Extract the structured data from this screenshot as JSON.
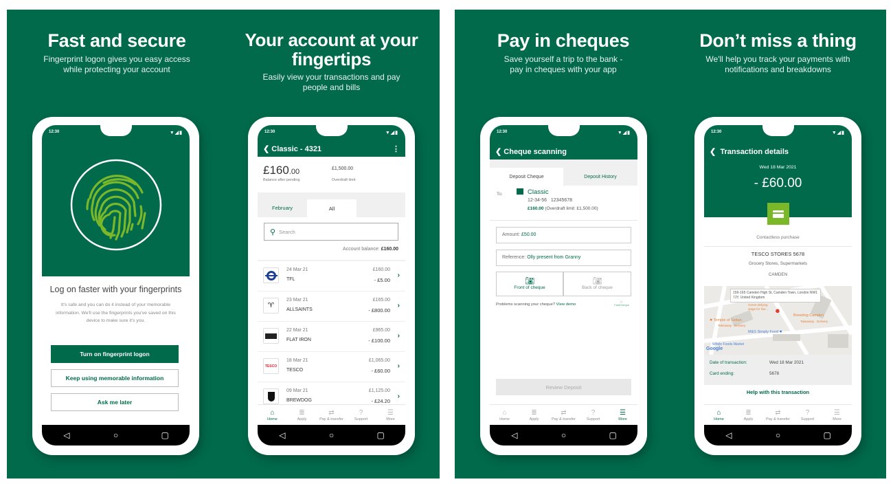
{
  "colors": {
    "brand_green": "#016a4b",
    "accent_lime": "#6ab023",
    "page_bg": "#ffffff"
  },
  "status_bar": {
    "time": "12:30",
    "icons": "▼◢▮"
  },
  "system_nav": {
    "back": "◁",
    "home": "○",
    "recents": "▢"
  },
  "tab_bar": [
    {
      "label": "Home",
      "icon": "home-icon",
      "glyph": "⌂"
    },
    {
      "label": "Apply",
      "icon": "apply-icon",
      "glyph": "≣"
    },
    {
      "label": "Pay & transfer",
      "icon": "pay-transfer-icon",
      "glyph": "⇄"
    },
    {
      "label": "Support",
      "icon": "support-icon",
      "glyph": "?"
    },
    {
      "label": "More",
      "icon": "menu-icon",
      "glyph": "☰"
    }
  ],
  "slides": [
    {
      "title": "Fast and secure",
      "subtitle": "Fingerprint logon gives you easy access while protecting your account"
    },
    {
      "title": "Your account at your fingertips",
      "subtitle": "Easily view your transactions and pay people and bills"
    },
    {
      "title": "Pay in cheques",
      "subtitle": "Save yourself a trip to the bank - pay in cheques with your app"
    },
    {
      "title": "Don’t miss a thing",
      "subtitle": "We'll help you track your payments with notifications and breakdowns"
    }
  ],
  "fingerprint": {
    "heading": "Log on faster with your fingerprints",
    "body": "It's safe and you can do it instead of your memorable information. We'll use the fingerprints you've saved on this device to make sure it's you.",
    "primary_button": "Turn on fingerprint logon",
    "secondary_button": "Keep using memorable information",
    "tertiary_button": "Ask me later"
  },
  "account": {
    "title": "Classic - 4321",
    "balance_main": "£160",
    "balance_pence": ".00",
    "balance_label": "Balance after pending",
    "overdraft": "£1,500.00",
    "overdraft_label": "Overdraft limit",
    "tabs": [
      "February",
      "All"
    ],
    "active_tab": "All",
    "search_placeholder": "Search",
    "account_balance_label": "Account balance:",
    "account_balance_value": "£160.00",
    "transactions": [
      {
        "date": "24 Mar 21",
        "name": "TFL",
        "balance": "£160.00",
        "amount": "- £5.00",
        "logo": "tfl-logo"
      },
      {
        "date": "23 Mar 21",
        "name": "ALLSAINTS",
        "balance": "£165.00",
        "amount": "- £800.00",
        "logo": "allsaints-logo"
      },
      {
        "date": "22 Mar 21",
        "name": "FLAT IRON",
        "balance": "£965.00",
        "amount": "- £100.00",
        "logo": "flat-iron-logo"
      },
      {
        "date": "18 Mar 21",
        "name": "TESCO",
        "balance": "£1,065.00",
        "amount": "- £60.00",
        "logo": "tesco-logo"
      },
      {
        "date": "09 Mar 21",
        "name": "BREWDOG",
        "balance": "£1,125.00",
        "amount": "- £24.20",
        "logo": "brewdog-logo"
      }
    ],
    "tesco_logo_text": "TESCO"
  },
  "cheque": {
    "title": "Cheque scanning",
    "tabs": [
      "Deposit Cheque",
      "Deposit History"
    ],
    "to_label": "To:",
    "account_name": "Classic",
    "sort_code": "12-34-56",
    "account_number": "12345678",
    "balance": "£160.00",
    "overdraft_note": "(Overdraft limit: £1,500.00)",
    "amount_label": "Amount:",
    "amount_value": "£50.00",
    "reference_label": "Reference:",
    "reference_value": "Olly present from Granny",
    "front_label": "Front of cheque",
    "back_label": "Back of cheque",
    "problem_text": "Problems scanning your cheque?",
    "view_demo": "View demo",
    "fastcheque": "FastCheque",
    "review_button": "Review Deposit"
  },
  "transaction": {
    "title": "Transaction details",
    "date": "Wed 18 Mar 2021",
    "amount": "- £60.00",
    "type": "Contactless purchase",
    "merchant": "TESCO STORES 5678",
    "category": "Grocery Stores, Supermarkets",
    "location": "CAMDEN",
    "map": {
      "address": "159-165 Camden High St, Camden Town, London NW1 7JY, United Kingdom",
      "poi": [
        "Genre-defying stage for live...",
        "Temple of Seitan",
        "Takeaway · Delivery",
        "Brewdog Camden",
        "Takeaway · Delivery",
        "M&S Simply Food",
        "Whole Foods Market"
      ],
      "attribution": "Google"
    },
    "date_label": "Date of transaction:",
    "date_value": "Wed 18 Mar 2021",
    "card_label": "Card ending:",
    "card_value": "5678",
    "help": "Help with this transaction"
  }
}
